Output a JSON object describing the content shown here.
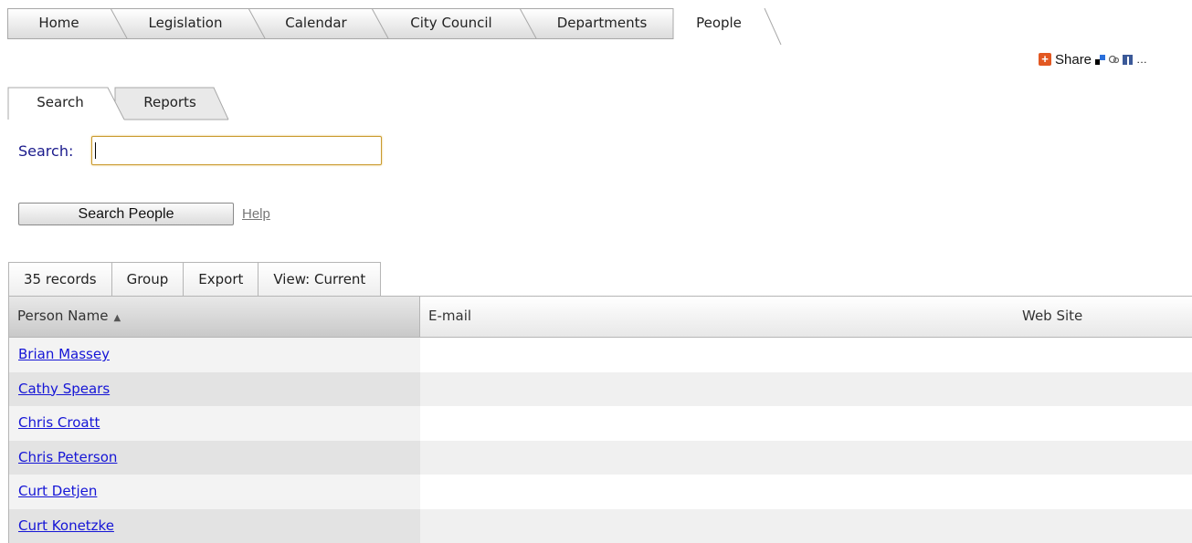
{
  "nav": {
    "tabs": [
      "Home",
      "Legislation",
      "Calendar",
      "City Council",
      "Departments",
      "People"
    ],
    "active": "People"
  },
  "share": {
    "label": "Share"
  },
  "subtabs": [
    "Search",
    "Reports"
  ],
  "search": {
    "label": "Search:",
    "value": "",
    "button_label": "Search People",
    "help_label": "Help"
  },
  "toolbar": {
    "records": "35 records",
    "group": "Group",
    "export": "Export",
    "view": "View: Current"
  },
  "table": {
    "columns": [
      "Person Name",
      "E-mail",
      "Web Site"
    ],
    "rows": [
      "Brian Massey",
      "Cathy Spears",
      "Chris Croatt",
      "Chris Peterson",
      "Curt Detjen",
      "Curt Konetzke"
    ]
  },
  "colors": {
    "link": "#1515d6",
    "label": "#1a1a8c",
    "input_focus_border": "#c99a2e",
    "share_icon": "#e25822"
  }
}
